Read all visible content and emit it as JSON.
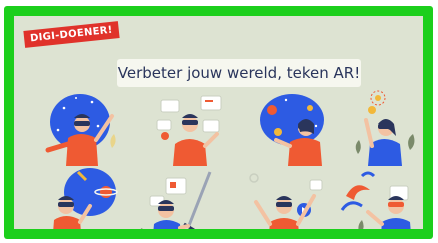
{
  "badge": {
    "label": "DIGI-DOENER!"
  },
  "banner": {
    "title": "Verbeter jouw wereld, teken AR!"
  },
  "colors": {
    "frame": "#1ccf1c",
    "panel": "#dde3d2",
    "badge": "#e0322a",
    "accent_blue": "#2d5be3",
    "accent_orange": "#ef5a33",
    "navy": "#2a355c"
  },
  "illustrations": [
    {
      "icon": "vr-headset-person-space-icon"
    },
    {
      "icon": "vr-headset-person-screens-icon"
    },
    {
      "icon": "vr-headset-person-planets-icon"
    },
    {
      "icon": "vr-headset-person-lightbulb-icon"
    },
    {
      "icon": "vr-headset-person-saturn-icon"
    },
    {
      "icon": "vr-headset-person-sword-icon"
    },
    {
      "icon": "vr-headset-person-controller-icon"
    },
    {
      "icon": "vr-headset-person-waves-icon"
    }
  ]
}
